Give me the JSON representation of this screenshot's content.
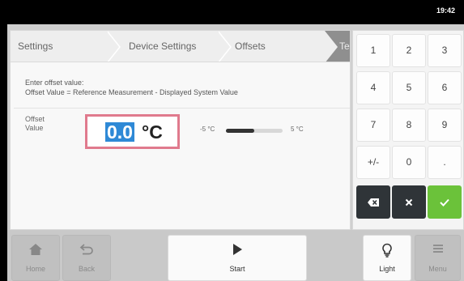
{
  "status": {
    "time": "19:42"
  },
  "breadcrumb": {
    "items": [
      {
        "label": "Settings"
      },
      {
        "label": "Device Settings"
      },
      {
        "label": "Offsets"
      },
      {
        "label": "Te"
      }
    ]
  },
  "instructions": {
    "line1": "Enter offset value:",
    "line2": "Offset Value = Reference Measurement - Displayed System Value"
  },
  "offset": {
    "label_line1": "Offset",
    "label_line2": "Value",
    "value": "0.0",
    "unit": "°C",
    "range_min": "-5 °C",
    "range_max": "5 °C",
    "range_fraction": 0.5
  },
  "keypad": {
    "keys": [
      "1",
      "2",
      "3",
      "4",
      "5",
      "6",
      "7",
      "8",
      "9",
      "+/-",
      "0",
      "."
    ],
    "backspace_icon": "backspace-icon",
    "clear_icon": "close-icon",
    "confirm_icon": "check-icon"
  },
  "footer": {
    "home": {
      "label": "Home",
      "icon": "home-icon"
    },
    "back": {
      "label": "Back",
      "icon": "back-arrow-icon"
    },
    "start": {
      "label": "Start",
      "icon": "play-icon"
    },
    "light": {
      "label": "Light",
      "icon": "lightbulb-icon"
    },
    "menu": {
      "label": "Menu",
      "icon": "menu-icon"
    }
  },
  "colors": {
    "accent_blue": "#2e89d6",
    "highlight_border": "#e07a8d",
    "confirm_green": "#6bc23a",
    "dark_key": "#2f3438"
  }
}
